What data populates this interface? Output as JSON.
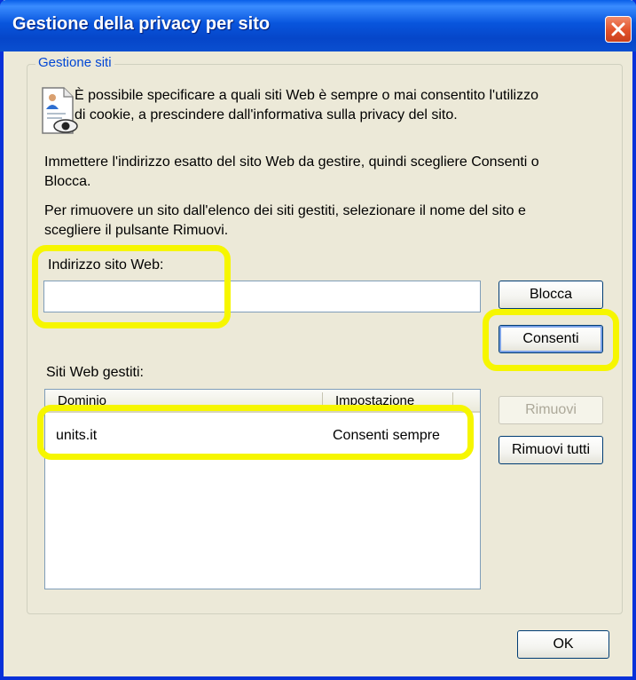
{
  "window": {
    "title": "Gestione della privacy per sito"
  },
  "group": {
    "legend": "Gestione siti"
  },
  "intro": {
    "line1": "È possibile specificare a quali siti Web è sempre o mai consentito l'utilizzo",
    "line2": "di cookie, a prescindere dall'informativa sulla privacy del sito."
  },
  "instructions": {
    "p1_line1": "Immettere l'indirizzo esatto del sito Web da gestire, quindi scegliere Consenti o",
    "p1_line2": "Blocca.",
    "p2_line1": "Per rimuovere un sito dall'elenco dei siti gestiti, selezionare il nome del sito e",
    "p2_line2": "scegliere il pulsante Rimuovi."
  },
  "address": {
    "label": "Indirizzo sito Web:",
    "value": "",
    "placeholder": ""
  },
  "buttons": {
    "block": "Blocca",
    "allow": "Consenti",
    "remove": "Rimuovi",
    "remove_all": "Rimuovi tutti",
    "ok": "OK"
  },
  "managed": {
    "label": "Siti Web gestiti:",
    "columns": [
      "Dominio",
      "Impostazione"
    ],
    "rows": [
      {
        "domain": "units.it",
        "setting": "Consenti sempre"
      }
    ]
  },
  "colors": {
    "highlight": "#f6f600",
    "titlebar": "#0855dd",
    "legend": "#0046d5"
  },
  "icons": [
    "close-icon",
    "privacy-document-icon"
  ]
}
